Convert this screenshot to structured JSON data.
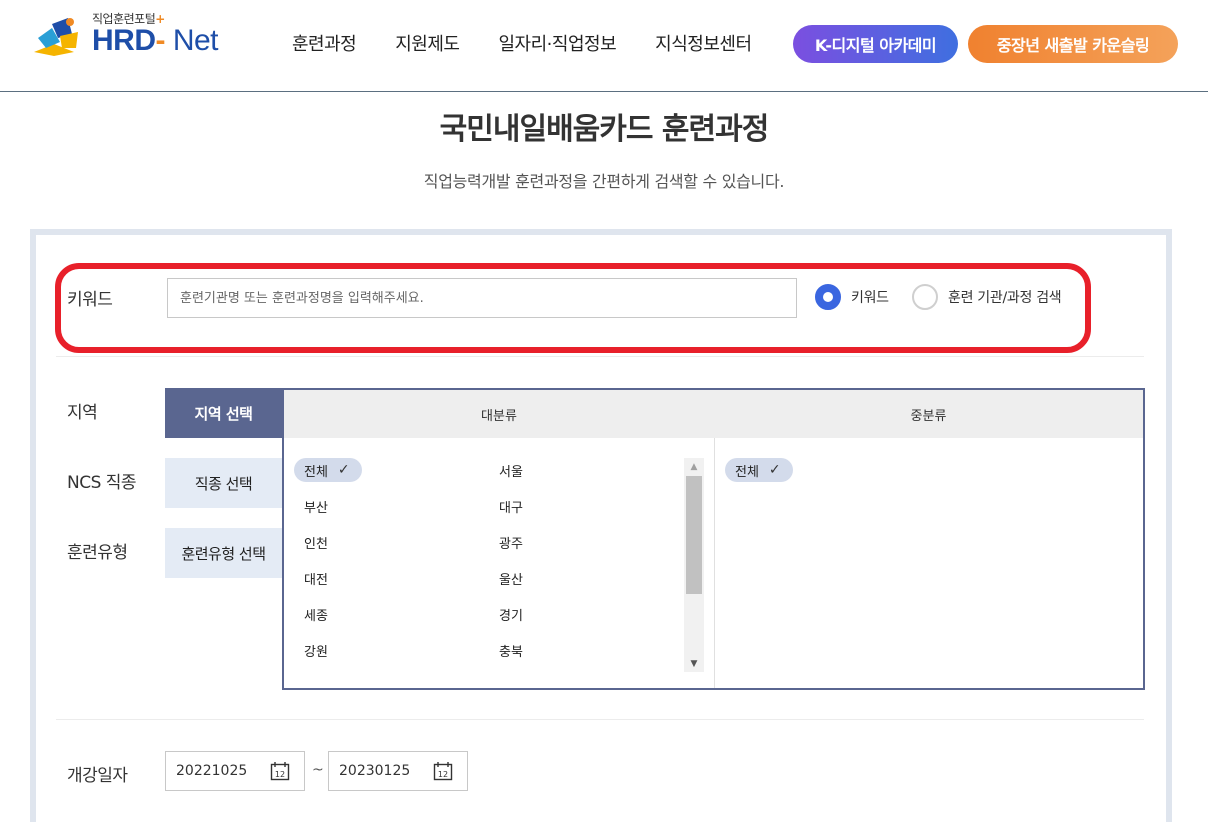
{
  "header": {
    "logo_sub": "직업훈련포털",
    "logo_plus": "+",
    "logo_main_a": "HRD",
    "logo_main_dash": "-",
    "logo_main_b": " Net",
    "nav": [
      "훈련과정",
      "지원제도",
      "일자리·직업정보",
      "지식정보센터"
    ],
    "pill_k": "K-디지털 아카데미",
    "pill_c": "중장년 새출발 카운슬링",
    "colors": {
      "pill_k_start": "#7b4fe0",
      "pill_k_end": "#3f6fe0",
      "pill_c_start": "#f0812f",
      "pill_c_end": "#f4a25a"
    }
  },
  "page": {
    "title": "국민내일배움카드 훈련과정",
    "subtitle": "직업능력개발 훈련과정을 간편하게 검색할 수 있습니다."
  },
  "keyword": {
    "label": "키워드",
    "placeholder": "훈련기관명 또는 훈련과정명을 입력해주세요.",
    "value": "",
    "radio_keyword": "키워드",
    "radio_institution": "훈련 기관/과정 검색",
    "selected": "키워드",
    "highlight_color": "#e8202a"
  },
  "filters": {
    "region_label": "지역",
    "ncs_label": "NCS 직종",
    "type_label": "훈련유형",
    "tab_region": "지역 선택",
    "tab_ncs": "직종 선택",
    "tab_type": "훈련유형 선택",
    "active_color": "#5a6690"
  },
  "region": {
    "major_header": "대분류",
    "minor_header": "중분류",
    "major_left": [
      "전체",
      "부산",
      "인천",
      "대전",
      "세종",
      "강원"
    ],
    "major_right": [
      "서울",
      "대구",
      "광주",
      "울산",
      "경기",
      "충북"
    ],
    "major_selected": "전체",
    "minor_items": [
      "전체"
    ],
    "check_glyph": "✓",
    "scroll_up": "▲",
    "scroll_down": "▼"
  },
  "dates": {
    "label": "개강일자",
    "start": "20221025",
    "end": "20230125",
    "separator": "~",
    "cal_day": "12"
  }
}
